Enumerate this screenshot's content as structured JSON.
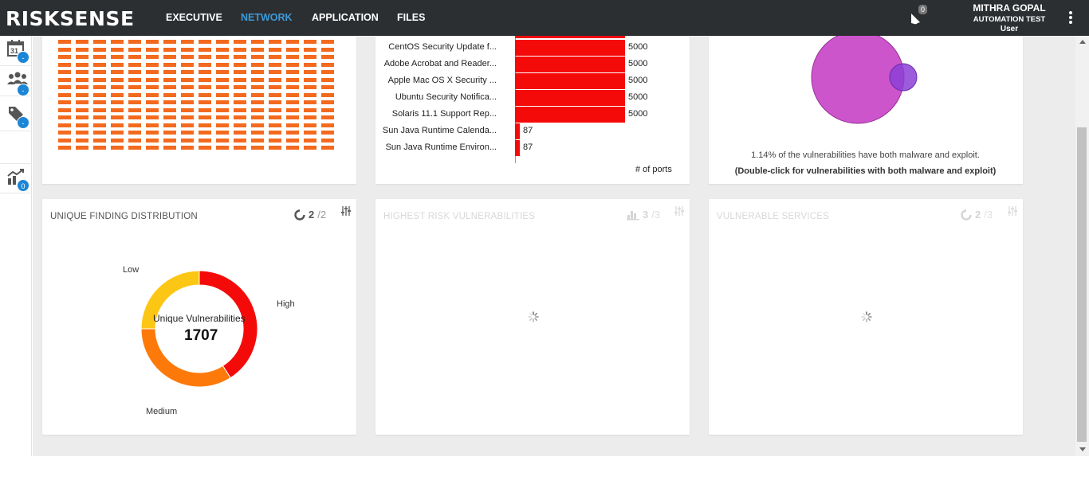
{
  "app": {
    "logo_text": "RISKSENSE"
  },
  "nav": {
    "items": [
      {
        "label": "EXECUTIVE",
        "active": false
      },
      {
        "label": "NETWORK",
        "active": true
      },
      {
        "label": "APPLICATION",
        "active": false
      },
      {
        "label": "FILES",
        "active": false
      }
    ]
  },
  "header": {
    "notification_count": "0",
    "user_name": "MITHRA GOPAL",
    "org_name": "AUTOMATION TEST",
    "role": "User"
  },
  "sidebar": {
    "items": [
      {
        "icon": "calendar-icon",
        "calendar_day": "31",
        "badge": "-"
      },
      {
        "icon": "users-icon",
        "badge": "-"
      },
      {
        "icon": "tag-icon",
        "badge": "-"
      },
      {
        "icon": "trend-chart-icon",
        "badge": "0"
      }
    ]
  },
  "colors": {
    "accent": "#1c86d6",
    "nav_active": "#3d9ad9",
    "waffle": "#f36a1f",
    "bar": "#f50a0a",
    "high": "#f50a0a",
    "medium": "#fd7a0a",
    "low": "#fcc614",
    "malware_circle": "#cc55cc",
    "exploit_circle": "#8b3fd6"
  },
  "top_bar_chart": {
    "type": "bar",
    "orientation": "horizontal",
    "categories": [
      "CentOS Security Update f...",
      "Adobe Acrobat and Reader...",
      "Apple Mac OS X Security ...",
      "Ubuntu Security Notifica...",
      "Solaris 11.1 Support Rep...",
      "Sun Java Runtime Calenda...",
      "Sun Java Runtime Environ..."
    ],
    "values": [
      5000,
      5000,
      5000,
      5000,
      5000,
      87,
      87
    ],
    "value_labels": [
      "5000",
      "5000",
      "5000",
      "5000",
      "5000",
      "87",
      "87"
    ],
    "xlabel": "# of ports",
    "xlim": [
      0,
      5000
    ]
  },
  "venn": {
    "note": "1.14% of the vulnerabilities have both malware and exploit.",
    "hint": "(Double-click for vulnerabilities with both malware and exploit)"
  },
  "cards": {
    "unique": {
      "title": "UNIQUE FINDING DISTRIBUTION",
      "page": "2",
      "total": "/2"
    },
    "highest": {
      "title": "HIGHEST RISK VULNERABILITIES",
      "page": "3",
      "total": "/3"
    },
    "services": {
      "title": "VULNERABLE SERVICES",
      "page": "2",
      "total": "/3"
    }
  },
  "chart_data": [
    {
      "type": "bar",
      "categories": [
        "CentOS Security Update f...",
        "Adobe Acrobat and Reader...",
        "Apple Mac OS X Security ...",
        "Ubuntu Security Notifica...",
        "Solaris 11.1 Support Rep...",
        "Sun Java Runtime Calenda...",
        "Sun Java Runtime Environ..."
      ],
      "values": [
        5000,
        5000,
        5000,
        5000,
        5000,
        87,
        87
      ],
      "xlabel": "# of ports",
      "ylabel": ""
    },
    {
      "type": "pie",
      "donut": true,
      "categories": [
        "High",
        "Medium",
        "Low"
      ],
      "values": [
        41,
        34,
        25
      ],
      "center_title": "Unique Vulnerabilities",
      "center_value": "1707"
    }
  ]
}
